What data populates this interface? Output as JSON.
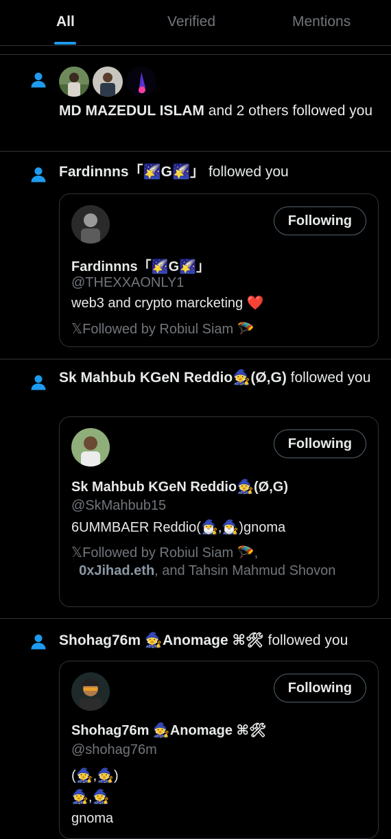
{
  "tabs": [
    {
      "label": "All",
      "active": true
    },
    {
      "label": "Verified",
      "active": false
    },
    {
      "label": "Mentions",
      "active": false
    }
  ],
  "colors": {
    "accent": "#1d9bf0",
    "background": "#000000",
    "muted": "#71767b",
    "heart": "#f91880"
  },
  "notifications": [
    {
      "icon": "person-icon",
      "actor": "MD MAZEDUL ISLAM",
      "rest": " and 2 others followed you"
    },
    {
      "icon": "person-icon",
      "actor": "Fardinnns「🌠G🌠」",
      "rest": " followed you",
      "card": {
        "button": "Following",
        "name": "Fardinnns「🌠G🌠」",
        "handle": "@THEXXAONLY1",
        "bio": "web3 and crypto marcketing ❤️",
        "followed_by": "𝕏Followed by Robiul Siam 🪂"
      }
    },
    {
      "icon": "person-icon",
      "actor": "Sk Mahbub KGeN Reddio🧙(Ø,G)",
      "rest": " followed you",
      "card": {
        "button": "Following",
        "name": "Sk Mahbub KGeN Reddio🧙(Ø,G)",
        "handle": "@SkMahbub15",
        "bio": "6UMMBAER Reddio(🧙‍♂️,🧙‍♂️)gnoma",
        "followed_by_prefix": "𝕏Followed by Robiul Siam 🪂,",
        "followed_by_bold": "0xJihad.eth",
        "followed_by_suffix": ", and Tahsin Mahmud Shovon"
      }
    },
    {
      "icon": "person-icon",
      "actor": "Shohag76m 🧙Anomage ⌘🛠",
      "rest": " followed you",
      "card": {
        "button": "Following",
        "name": "Shohag76m 🧙Anomage ⌘🛠",
        "handle": "@shohag76m",
        "bio_lines": [
          "(🧙,🧙)",
          "🧙,🧙",
          "gnoma"
        ]
      }
    }
  ]
}
